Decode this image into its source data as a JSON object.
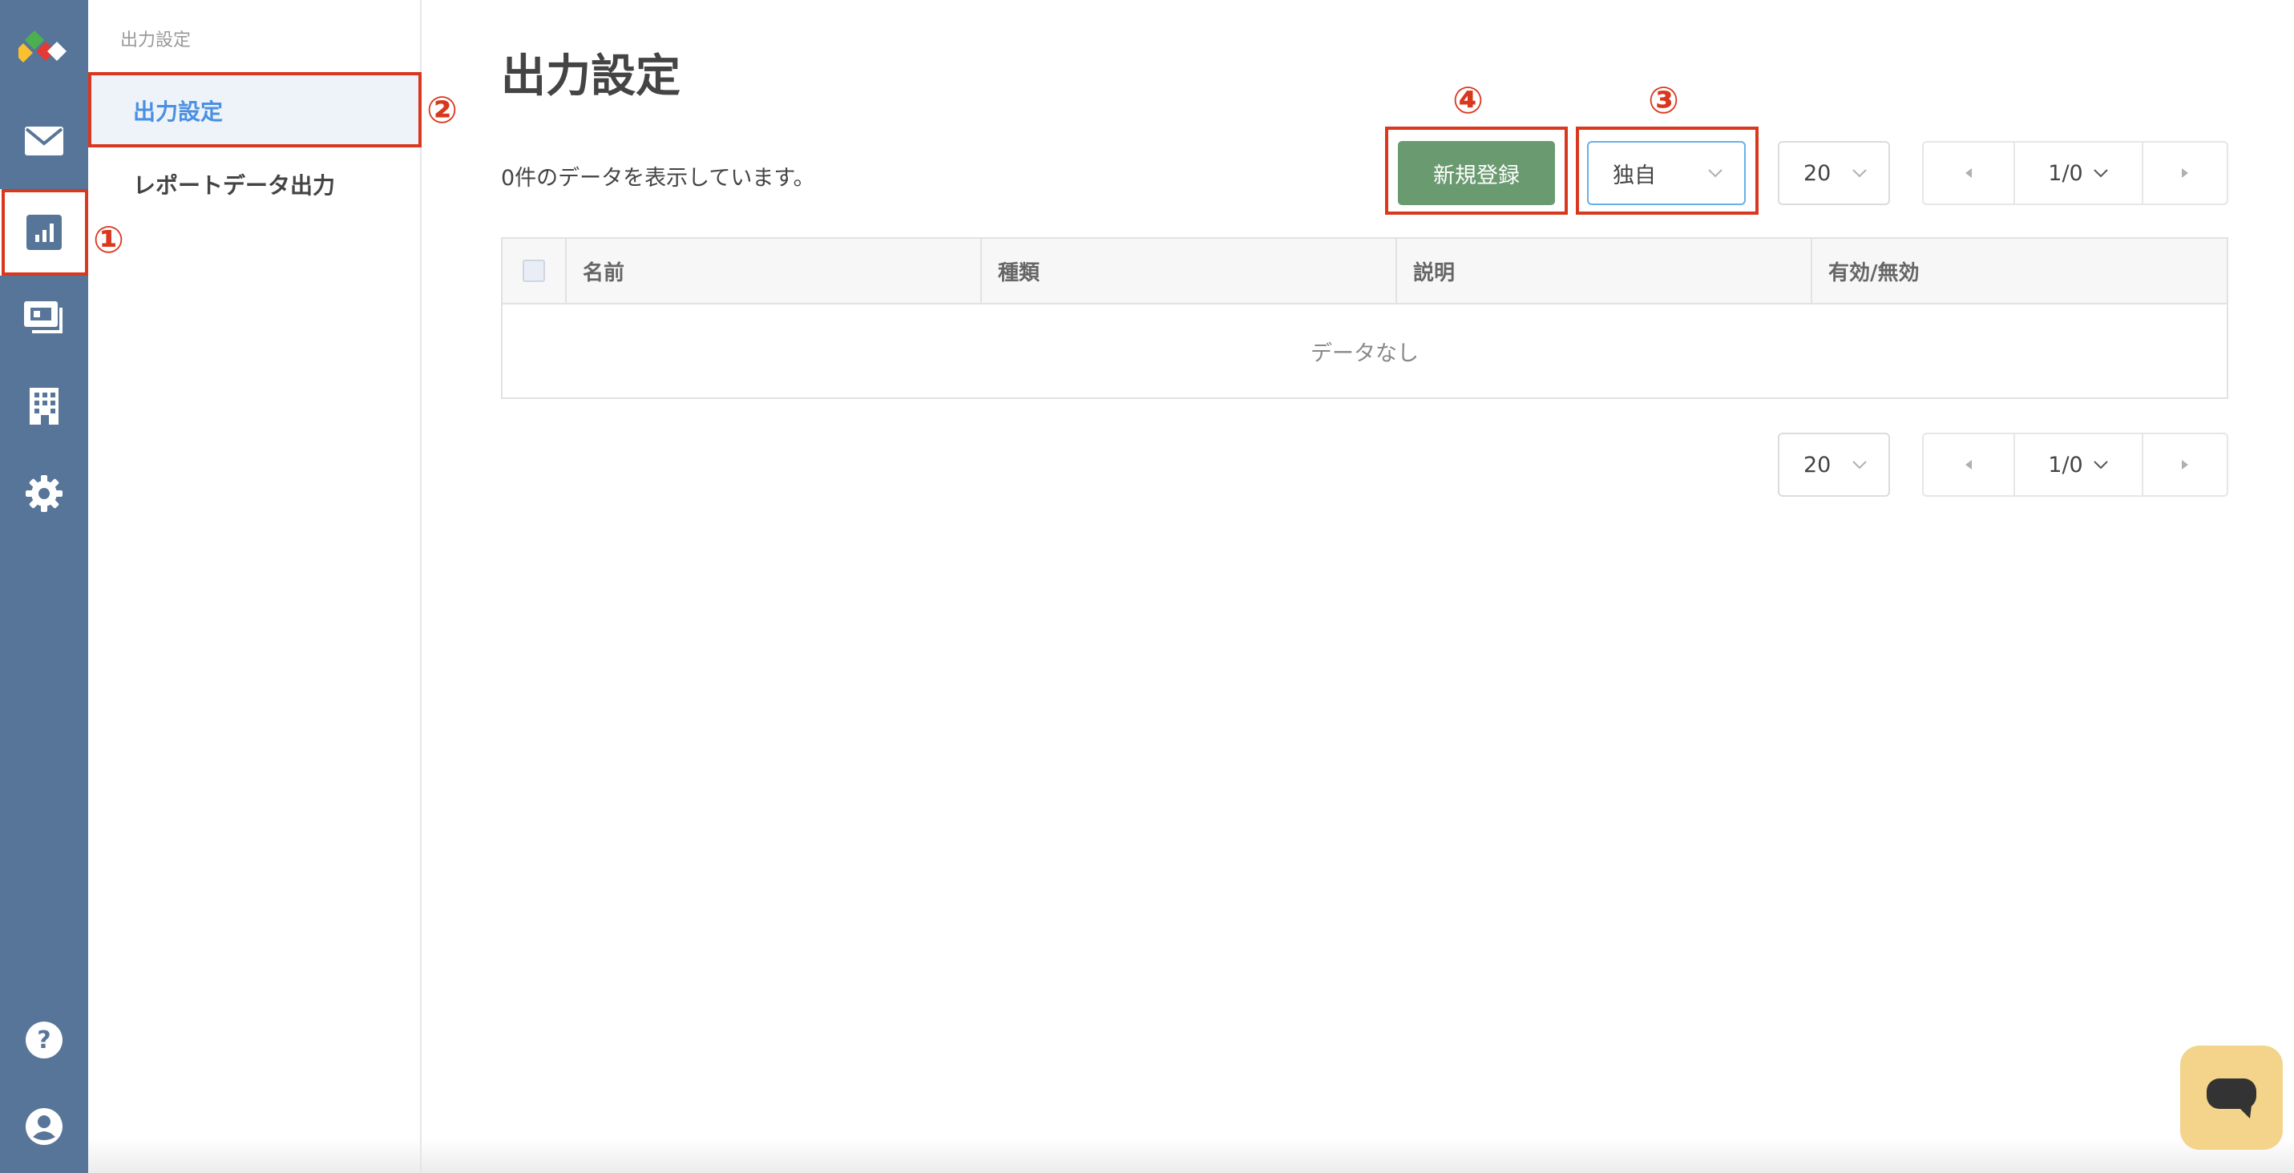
{
  "rail": {
    "items": [
      {
        "icon": "app-logo-icon"
      },
      {
        "icon": "mail-icon"
      },
      {
        "icon": "report-chart-icon"
      },
      {
        "icon": "id-card-icon"
      },
      {
        "icon": "building-icon"
      },
      {
        "icon": "gear-icon"
      },
      {
        "icon": "help-icon"
      },
      {
        "icon": "user-icon"
      }
    ],
    "active_index": 2
  },
  "subnav": {
    "header": "出力設定",
    "items": [
      {
        "label": "出力設定",
        "active": true
      },
      {
        "label": "レポートデータ出力",
        "active": false
      }
    ]
  },
  "main": {
    "title": "出力設定",
    "count_text": "0件のデータを表示しています。",
    "new_button_label": "新規登録",
    "type_select": {
      "value": "独自"
    },
    "page_size_top": "20",
    "page_size_bottom": "20",
    "pager_top": {
      "current": "1/0"
    },
    "pager_bottom": {
      "current": "1/0"
    },
    "table": {
      "columns": [
        "名前",
        "種類",
        "説明",
        "有効/無効"
      ],
      "empty_text": "データなし"
    }
  },
  "annotations": [
    "①",
    "②",
    "③",
    "④"
  ],
  "colors": {
    "rail": "#577599",
    "primary_button": "#6a9a6f",
    "active_nav_text": "#4a90e2",
    "annotation_red": "#d9381e",
    "chat_widget": "#f4d38a"
  }
}
